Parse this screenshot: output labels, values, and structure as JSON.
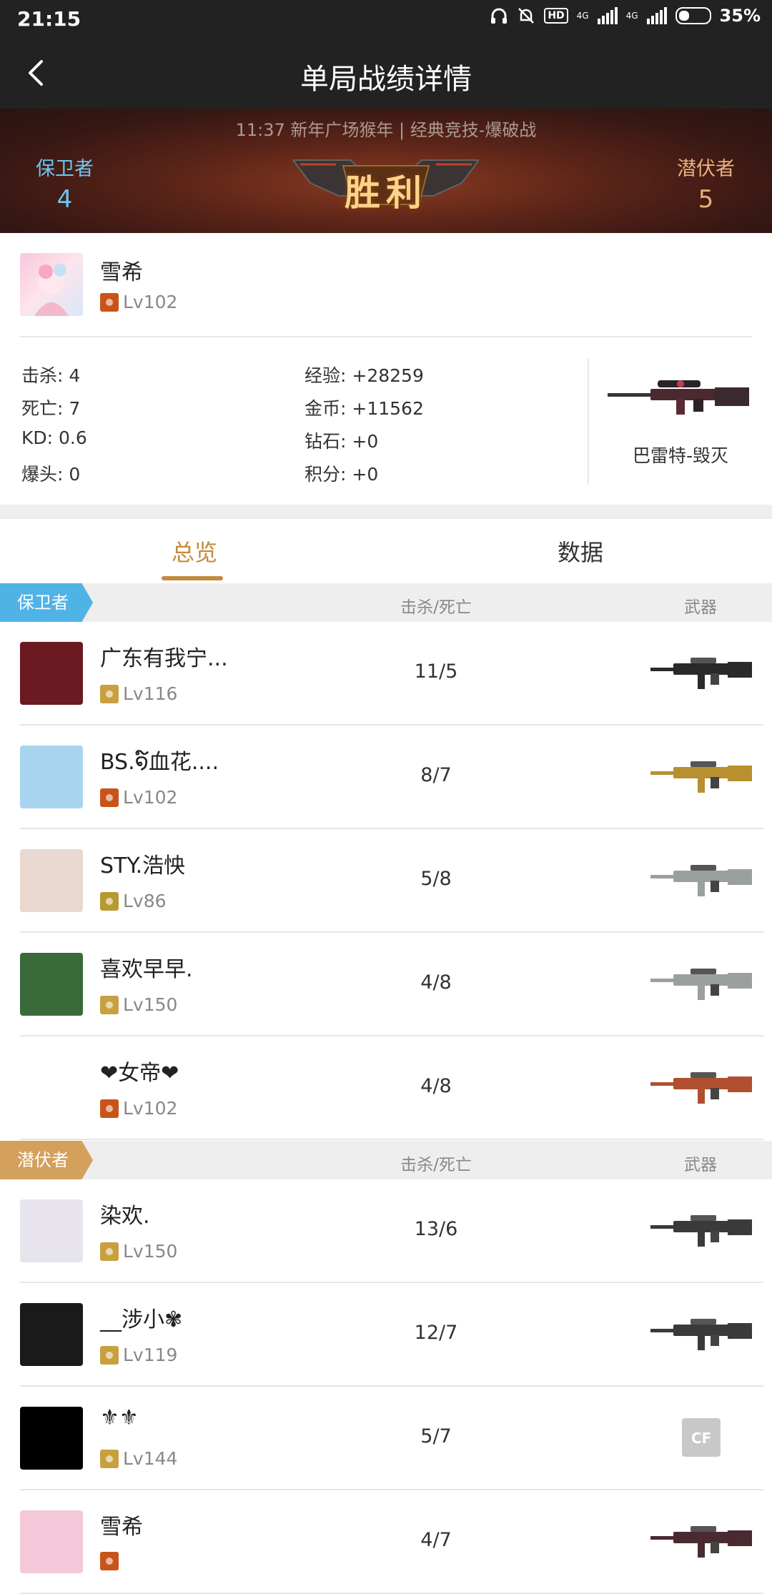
{
  "status_bar": {
    "time": "21:15",
    "hd": "HD",
    "net1": "4G",
    "net2": "4G",
    "battery": "35%"
  },
  "header": {
    "title": "单局战绩详情"
  },
  "match": {
    "info": "11:37 新年广场猴年 | 经典竞技-爆破战",
    "defender_label": "保卫者",
    "defender_score": "4",
    "attacker_label": "潜伏者",
    "attacker_score": "5",
    "result": "胜利"
  },
  "player": {
    "name": "雪希",
    "level": "Lv102",
    "stats_left": [
      "击杀: 4",
      "死亡: 7",
      "KD: 0.6",
      "爆头: 0"
    ],
    "stats_right": [
      "经验: +28259",
      "金币: +11562",
      "钻石: +0",
      "积分: +0"
    ],
    "weapon": "巴雷特-毁灭"
  },
  "tabs": {
    "overview": "总览",
    "data": "数据"
  },
  "defenders": {
    "label": "保卫者",
    "col_kd": "击杀/死亡",
    "col_weapon": "武器",
    "rows": [
      {
        "name": "广东有我宁...",
        "level": "Lv116",
        "kd": "11/5",
        "badge": "#c8a040",
        "avatar": "#6a1a20",
        "gun": "#2a2a2a"
      },
      {
        "name": "BS.໑໌血花....",
        "level": "Lv102",
        "kd": "8/7",
        "badge": "#c8541a",
        "avatar": "#a8d4f0",
        "gun": "#b89030"
      },
      {
        "name": "STY.浩怏",
        "level": "Lv86",
        "kd": "5/8",
        "badge": "#b89a30",
        "avatar": "#e8d8d0",
        "gun": "#9aa0a0"
      },
      {
        "name": "喜欢早早.",
        "level": "Lv150",
        "kd": "4/8",
        "badge": "#c8a040",
        "avatar": "#3a6a3a",
        "gun": "#9aa0a0"
      },
      {
        "name": "❤女帝❤",
        "level": "Lv102",
        "kd": "4/8",
        "badge": "#c8541a",
        "avatar": "#ffffff",
        "gun": "#b05030"
      }
    ]
  },
  "attackers": {
    "label": "潜伏者",
    "col_kd": "击杀/死亡",
    "col_weapon": "武器",
    "rows": [
      {
        "name": "染欢.",
        "level": "Lv150",
        "kd": "13/6",
        "badge": "#c8a040",
        "avatar": "#e8e4ee",
        "gun": "#3a3a3a"
      },
      {
        "name": "__涉小✾",
        "level": "Lv119",
        "kd": "12/7",
        "badge": "#c8a040",
        "avatar": "#1a1a1a",
        "gun": "#3a3a3a"
      },
      {
        "name": "⚜⚜",
        "level": "Lv144",
        "kd": "5/7",
        "badge": "#c8a040",
        "avatar": "#000000",
        "gun": "none"
      },
      {
        "name": "雪希",
        "level": "",
        "kd": "4/7",
        "badge": "#c8541a",
        "avatar": "#f4c8d8",
        "gun": "#4a2a30"
      }
    ]
  },
  "colors": {
    "defender": "#4fb3e6",
    "attacker": "#d3a15c",
    "accent": "#c48a3d"
  }
}
